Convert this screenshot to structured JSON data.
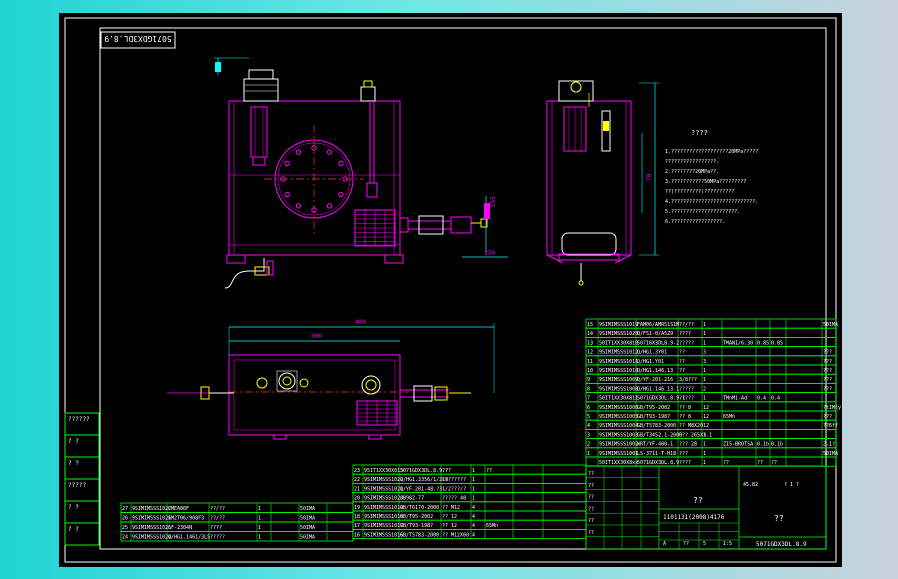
{
  "drawing": {
    "code_title_box": "5071GDX3DL.8.9",
    "code_bottom": "5071GDX3DL.8.9",
    "company_name_box": "??",
    "drawing_name_box": "??",
    "scale_box": "1101131(2008)4176",
    "tech_req_title": "????",
    "tech_req_lines": [
      "1.???????????????????20MPa?????",
      "  ?????????????????.",
      "2.????????20MPa??.",
      "3.???????????50MPa?????????",
      "  ??(?????????)??????????",
      "4.????????????????????????????.",
      "5.??????????????????????.",
      "6.?????????????????."
    ],
    "dims": {
      "length_top": "400",
      "length_inner": "300",
      "height_side": "70",
      "small_dim_a": "370",
      "small_dim_b": "155"
    }
  },
  "left_side_table": {
    "cells": [
      "??????",
      "? ?",
      "? ?",
      "?????",
      "? ?",
      "? ?"
    ]
  },
  "bom_right": [
    {
      "no": "15",
      "code": "9SIMIMSSS1019",
      "name": "FAM06/AMR51S1M",
      "desc": "??/??",
      "qty": "1",
      "mat": "",
      "w1": "",
      "w2": "",
      "note": "50IMA"
    },
    {
      "no": "14",
      "code": "9SIMIMSSS1020",
      "name": "Q/FS1-0/A5Z9",
      "desc": "????",
      "qty": "1",
      "mat": "",
      "w1": "",
      "w2": "",
      "note": ""
    },
    {
      "no": "13",
      "code": "50IT1XX30X810",
      "name": "507I6X3DL8.9-2",
      "desc": "?????",
      "qty": "1",
      "mat": "TMANI/6.30",
      "w1": "0.85",
      "w2": "0.85",
      "note": ""
    },
    {
      "no": "12",
      "code": "9SIMIMSSS1012",
      "name": "Q/HG1.3Y01",
      "desc": "??",
      "qty": "3",
      "mat": "",
      "w1": "",
      "w2": "",
      "note": "???"
    },
    {
      "no": "11",
      "code": "9SIMIMSSS1011",
      "name": "Q/HG1.Y01",
      "desc": "??",
      "qty": "3",
      "mat": "",
      "w1": "",
      "w2": "",
      "note": "???"
    },
    {
      "no": "10",
      "code": "9SIMIMSSS1010",
      "name": "Q/HG1.146.13",
      "desc": "??",
      "qty": "1",
      "mat": "",
      "w1": "",
      "w2": "",
      "note": "???"
    },
    {
      "no": "9",
      "code": "9SIMIMSSS1009",
      "name": "Q/YF-201-216",
      "desc": "3/8???",
      "qty": "1",
      "mat": "",
      "w1": "",
      "w2": "",
      "note": "???"
    },
    {
      "no": "8",
      "code": "9SIMIMSSS1008",
      "name": "Q/HG1.146.13.1",
      "desc": "?????",
      "qty": "2",
      "mat": "",
      "w1": "",
      "w2": "",
      "note": "???"
    },
    {
      "no": "7",
      "code": "50IT1XX30X811",
      "name": "5071GDX3DL.8.9-1",
      "desc": "?????",
      "qty": "1",
      "mat": "TMnM1-Ad",
      "w1": "0.4",
      "w2": "0.4",
      "note": ""
    },
    {
      "no": "6",
      "code": "9SIMIMSSS1006",
      "name": "GB/T95-2002",
      "desc": "?? 8",
      "qty": "12",
      "mat": "",
      "w1": "",
      "w2": "",
      "note": "?tIMty"
    },
    {
      "no": "5",
      "code": "9SIMIMSSS1005",
      "name": "GB/T93-1987",
      "desc": "?? 8",
      "qty": "12",
      "mat": "65Mn",
      "w1": "",
      "w2": "",
      "note": "???"
    },
    {
      "no": "4",
      "code": "9SIMIMSSS1004",
      "name": "GB/T5783-2000",
      "desc": "?? M8X20",
      "qty": "12",
      "mat": "",
      "w1": "",
      "w2": "",
      "note": "??6ff"
    },
    {
      "no": "3",
      "code": "9SIMIMSSS1003",
      "name": "GB/T3452.1-2005",
      "desc": "O?? 265X3.1",
      "qty": "1",
      "mat": "",
      "w1": "",
      "w2": "",
      "note": ""
    },
    {
      "no": "2",
      "code": "9SIMIMSSS1002",
      "name": "WRT/YF-400-1",
      "desc": "??? 28",
      "qty": "1",
      "mat": "ZIS-BROTSA",
      "w1": "0.1b",
      "w2": "0.1b",
      "note": "Z.1?"
    },
    {
      "no": "1",
      "code": "9SIMIMSSS1001",
      "name": "LS-3711-T-H18",
      "desc": "???",
      "qty": "1",
      "mat": "",
      "w1": "",
      "w2": "",
      "note": "50IMA"
    },
    {
      "no": "",
      "code": "50IT1XX30X8xx",
      "name": "5071GDX3DL.8.9",
      "desc": "????",
      "qty": "1",
      "mat": "??",
      "w1": "??",
      "w2": "??",
      "note": ""
    }
  ],
  "bom_mid": [
    {
      "no": "23",
      "code": "95IT1XX30X813",
      "name": "5071GDX3DL.8.9.?",
      "desc": "???",
      "qty": "1",
      "mat": "??",
      "note": ""
    },
    {
      "no": "22",
      "code": "9SIMIMSSS1022",
      "name": "Q/HG1.3356/1/2L8",
      "desc": "????????",
      "qty": "1",
      "mat": "",
      "note": ""
    },
    {
      "no": "21",
      "code": "9SIMIMSSS1021",
      "name": "Q/YF-201-48.?3",
      "desc": "1/2???/?",
      "qty": "1",
      "mat": "",
      "note": ""
    },
    {
      "no": "20",
      "code": "9SIMIMSSS1020",
      "name": "JB982-77",
      "desc": "????? 48",
      "qty": "1",
      "mat": "",
      "note": ""
    },
    {
      "no": "19",
      "code": "9SIMIMSSS1019",
      "name": "GB/T6170-2000",
      "desc": "?? M12",
      "qty": "4",
      "mat": "",
      "note": ""
    },
    {
      "no": "18",
      "code": "9SIMIMSSS1018",
      "name": "GB/T95-2002",
      "desc": "?? 12",
      "qty": "4",
      "mat": "",
      "note": ""
    },
    {
      "no": "17",
      "code": "9SIMIMSSS1017",
      "name": "GB/T93-1987",
      "desc": "?? 12",
      "qty": "4",
      "mat": "65Mn",
      "note": ""
    },
    {
      "no": "16",
      "code": "9SIMIMSSS1016",
      "name": "GB/T5783-2000",
      "desc": "?? M12X60",
      "qty": "4",
      "mat": "",
      "note": ""
    }
  ],
  "bom_left": [
    {
      "no": "27",
      "code": "9SIMIMSSS1027",
      "name": "LMEA00F",
      "desc": "??/??",
      "qty": "1",
      "note": "50IMA"
    },
    {
      "no": "26",
      "code": "9SIMIMSSS1026",
      "name": "1M2T06/908F3",
      "desc": "??/??",
      "qty": "1",
      "note": "50IMA"
    },
    {
      "no": "25",
      "code": "9SIMIMSSS1025",
      "name": "LF-2304N",
      "desc": "????",
      "qty": "1",
      "note": "50IMA"
    },
    {
      "no": "24",
      "code": "9SIMIMSSS1024",
      "name": "Q/HG1.1461/3L5",
      "desc": "?????",
      "qty": "1",
      "note": "50IMA"
    }
  ],
  "title_block": {
    "signatures": [
      "??",
      "??",
      "??",
      "??",
      "??",
      "??"
    ],
    "marks": [
      "A",
      "??",
      "5",
      "1:5"
    ],
    "weight": "45.82",
    "sheet": "? 1 ?"
  },
  "colors": {
    "background": "#000000",
    "frame": "#ffffff",
    "table": "#00ff00",
    "table_text": "#ffffff",
    "outline": "#ff00ff",
    "centerline": "#ff3030",
    "dimension": "#00ffff",
    "fitting": "#ffff00",
    "note_text": "#ffffff"
  }
}
